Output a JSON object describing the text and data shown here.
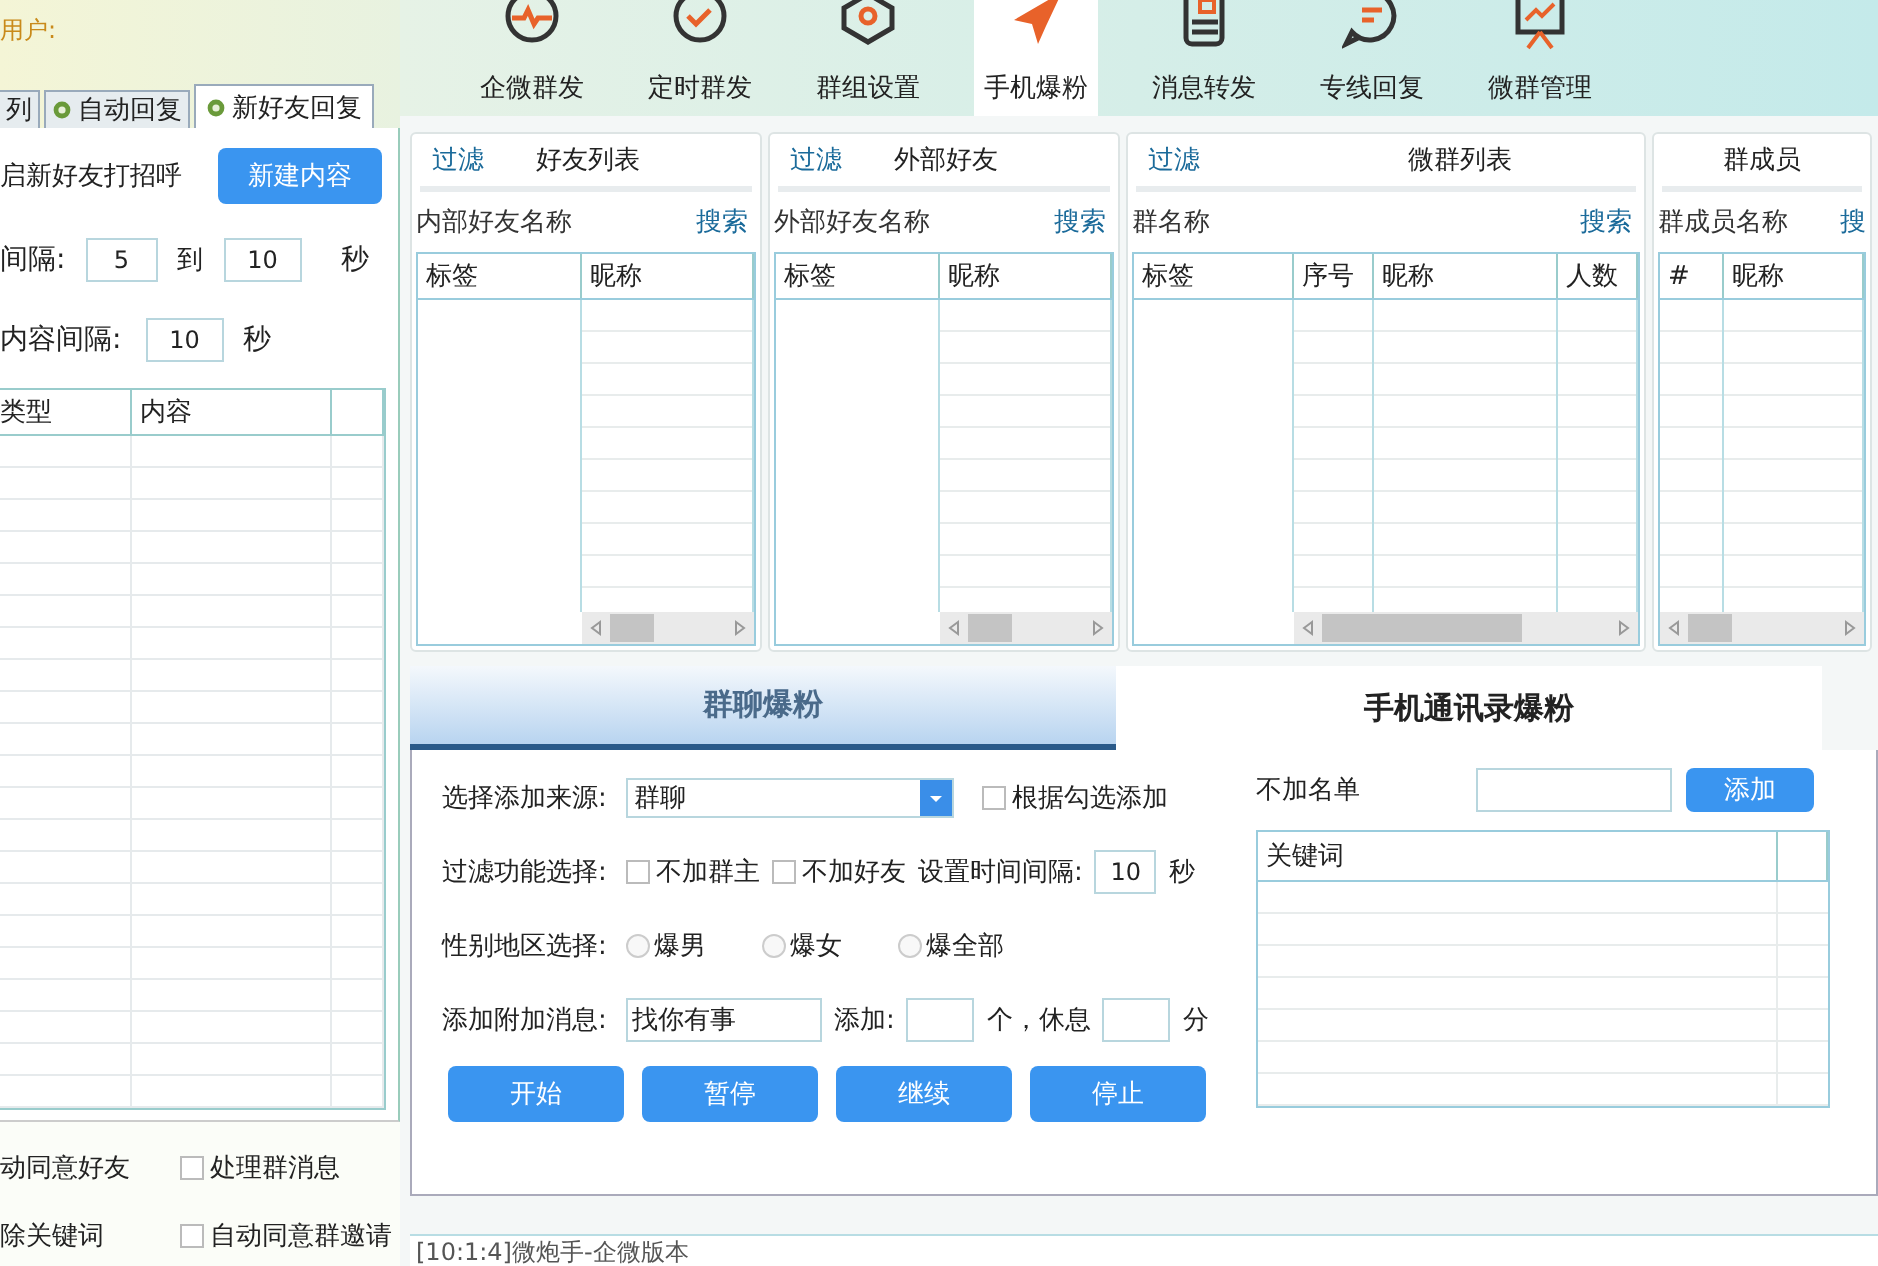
{
  "user_label": "用户:",
  "left_tabs": [
    {
      "label": "列",
      "selected": false,
      "icon": false
    },
    {
      "label": "自动回复",
      "selected": false,
      "icon": true
    },
    {
      "label": "新好友回复",
      "selected": true,
      "icon": true
    }
  ],
  "greeting": {
    "label": "启新好友打招呼",
    "button": "新建内容"
  },
  "interval": {
    "label": "间隔:",
    "from": "5",
    "to_label": "到",
    "to": "10",
    "unit": "秒"
  },
  "content_interval": {
    "label": "内容间隔:",
    "value": "10",
    "unit": "秒"
  },
  "reply_table": {
    "columns": [
      "类型",
      "内容"
    ]
  },
  "left_options": [
    {
      "kind": "text",
      "label": "动同意好友"
    },
    {
      "kind": "checkbox",
      "label": "处理群消息",
      "checked": false
    },
    {
      "kind": "text",
      "label": "除关键词"
    },
    {
      "kind": "checkbox",
      "label": "自动同意群邀请",
      "checked": false
    }
  ],
  "toolbar": [
    {
      "label": "企微群发",
      "selected": false
    },
    {
      "label": "定时群发",
      "selected": false
    },
    {
      "label": "群组设置",
      "selected": false
    },
    {
      "label": "手机爆粉",
      "selected": true
    },
    {
      "label": "消息转发",
      "selected": false
    },
    {
      "label": "专线回复",
      "selected": false
    },
    {
      "label": "微群管理",
      "selected": false
    }
  ],
  "panels": [
    {
      "filter": "过滤",
      "title": "好友列表",
      "search_label": "内部好友名称",
      "search": "搜索",
      "columns": [
        "标签",
        "昵称"
      ]
    },
    {
      "filter": "过滤",
      "title": "外部好友",
      "search_label": "外部好友名称",
      "search": "搜索",
      "columns": [
        "标签",
        "昵称"
      ]
    },
    {
      "filter": "过滤",
      "title": "微群列表",
      "search_label": "群名称",
      "search": "搜索",
      "columns": [
        "标签",
        "序号",
        "昵称",
        "人数"
      ]
    },
    {
      "title": "群成员",
      "search_label": "群成员名称",
      "search": "搜",
      "columns": [
        "#",
        "昵称"
      ]
    }
  ],
  "mode_tabs": [
    {
      "label": "群聊爆粉",
      "selected": true
    },
    {
      "label": "手机通讯录爆粉",
      "selected": false
    }
  ],
  "source": {
    "label": "选择添加来源:",
    "value": "群聊",
    "check_label": "根据勾选添加",
    "checked": false
  },
  "filter": {
    "label": "过滤功能选择:",
    "options": [
      {
        "label": "不加群主",
        "checked": false
      },
      {
        "label": "不加好友",
        "checked": false
      }
    ],
    "interval_label": "设置时间间隔:",
    "interval": "10",
    "unit": "秒"
  },
  "gender": {
    "label": "性别地区选择:",
    "options": [
      {
        "label": "爆男",
        "selected": false
      },
      {
        "label": "爆女",
        "selected": false
      },
      {
        "label": "爆全部",
        "selected": false
      }
    ]
  },
  "message": {
    "label": "添加附加消息:",
    "value": "找你有事",
    "add_label": "添加:",
    "count_unit": "个，休息",
    "rest_unit": "分"
  },
  "actions": [
    "开始",
    "暂停",
    "继续",
    "停止"
  ],
  "blacklist": {
    "label": "不加名单",
    "button": "添加",
    "column": "关键词"
  },
  "log": [
    "[10:1:4]微炮手-企微版本"
  ]
}
